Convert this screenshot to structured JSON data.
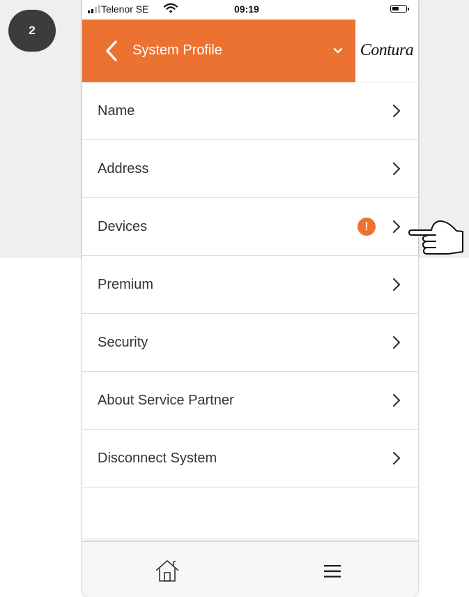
{
  "step_badge": "2",
  "status_bar": {
    "carrier": "Telenor SE",
    "time": "09:19"
  },
  "header": {
    "title": "System Profile",
    "back_icon": "chevron-left-icon",
    "dropdown_icon": "chevron-down-icon",
    "logo": "Contura"
  },
  "menu": {
    "items": [
      {
        "label": "Name",
        "alert": false
      },
      {
        "label": "Address",
        "alert": false
      },
      {
        "label": "Devices",
        "alert": true,
        "alert_symbol": "!"
      },
      {
        "label": "Premium",
        "alert": false
      },
      {
        "label": "Security",
        "alert": false
      },
      {
        "label": "About Service Partner",
        "alert": false
      },
      {
        "label": "Disconnect System",
        "alert": false
      }
    ]
  },
  "bottom_nav": {
    "home_icon": "home-icon",
    "menu_icon": "hamburger-menu-icon"
  },
  "colors": {
    "accent": "#ec7232",
    "badge_bg": "#3c3c3c"
  }
}
